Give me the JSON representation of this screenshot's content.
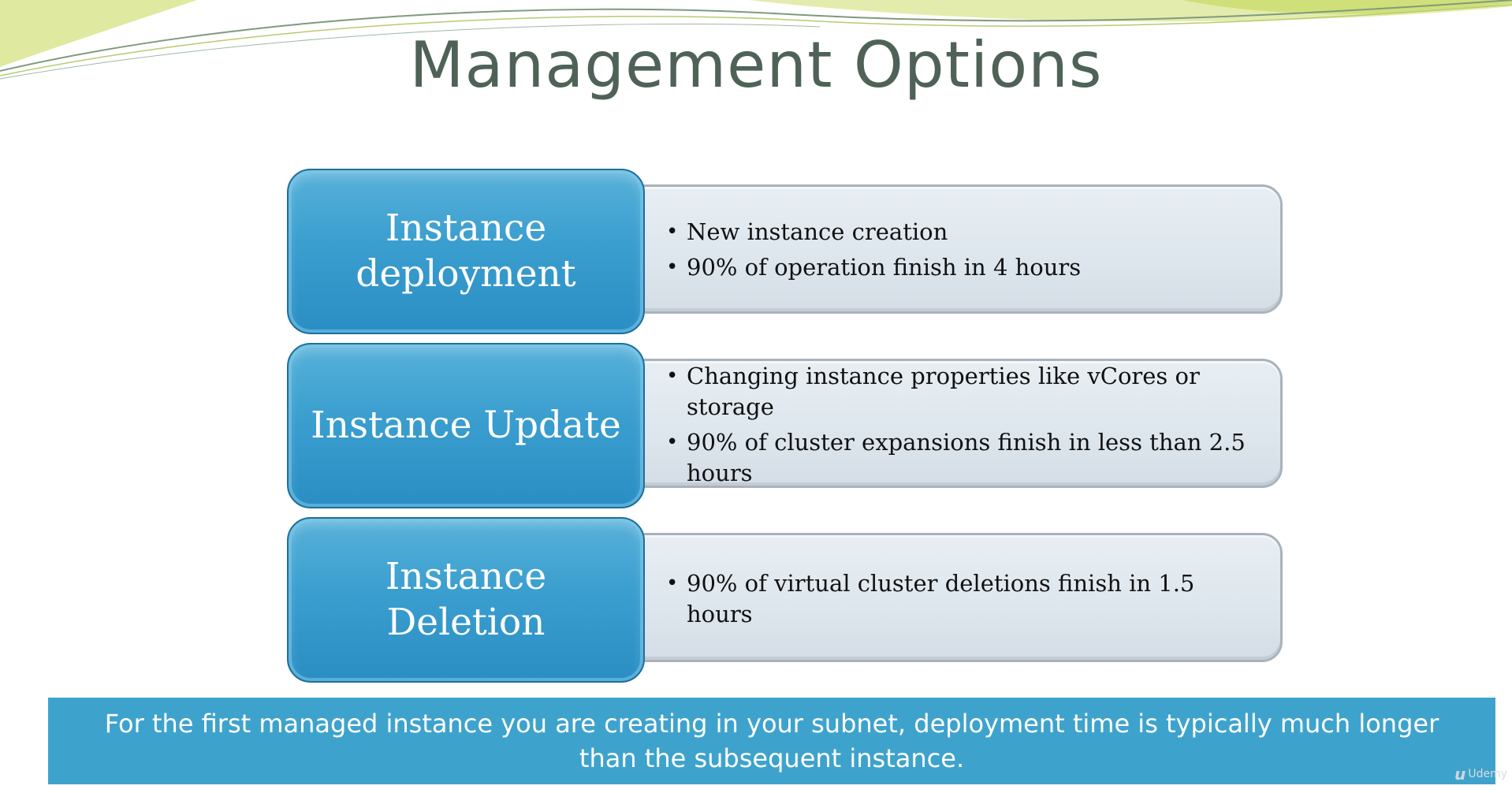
{
  "slide": {
    "title": "Management Options",
    "rows": [
      {
        "heading": "Instance deployment",
        "bullets": [
          "New instance creation",
          "90% of operation finish in 4 hours"
        ]
      },
      {
        "heading": "Instance Update",
        "bullets": [
          "Changing instance properties like vCores or storage",
          "90% of cluster expansions finish in less than 2.5 hours"
        ]
      },
      {
        "heading": "Instance Deletion",
        "bullets": [
          "90% of virtual cluster deletions finish in 1.5 hours"
        ]
      }
    ],
    "note": "For the first managed instance you are creating in your subnet, deployment time is typically much longer than the subsequent instance.",
    "bullet_char": "•"
  },
  "watermark": {
    "logo": "u",
    "text": "Udemy"
  },
  "colors": {
    "title": "#4e6258",
    "heading_box": "#3a9ecf",
    "detail_box": "#dde6ed",
    "note_bar": "#3ea3cc",
    "swoosh_green": "#d6e68a"
  }
}
